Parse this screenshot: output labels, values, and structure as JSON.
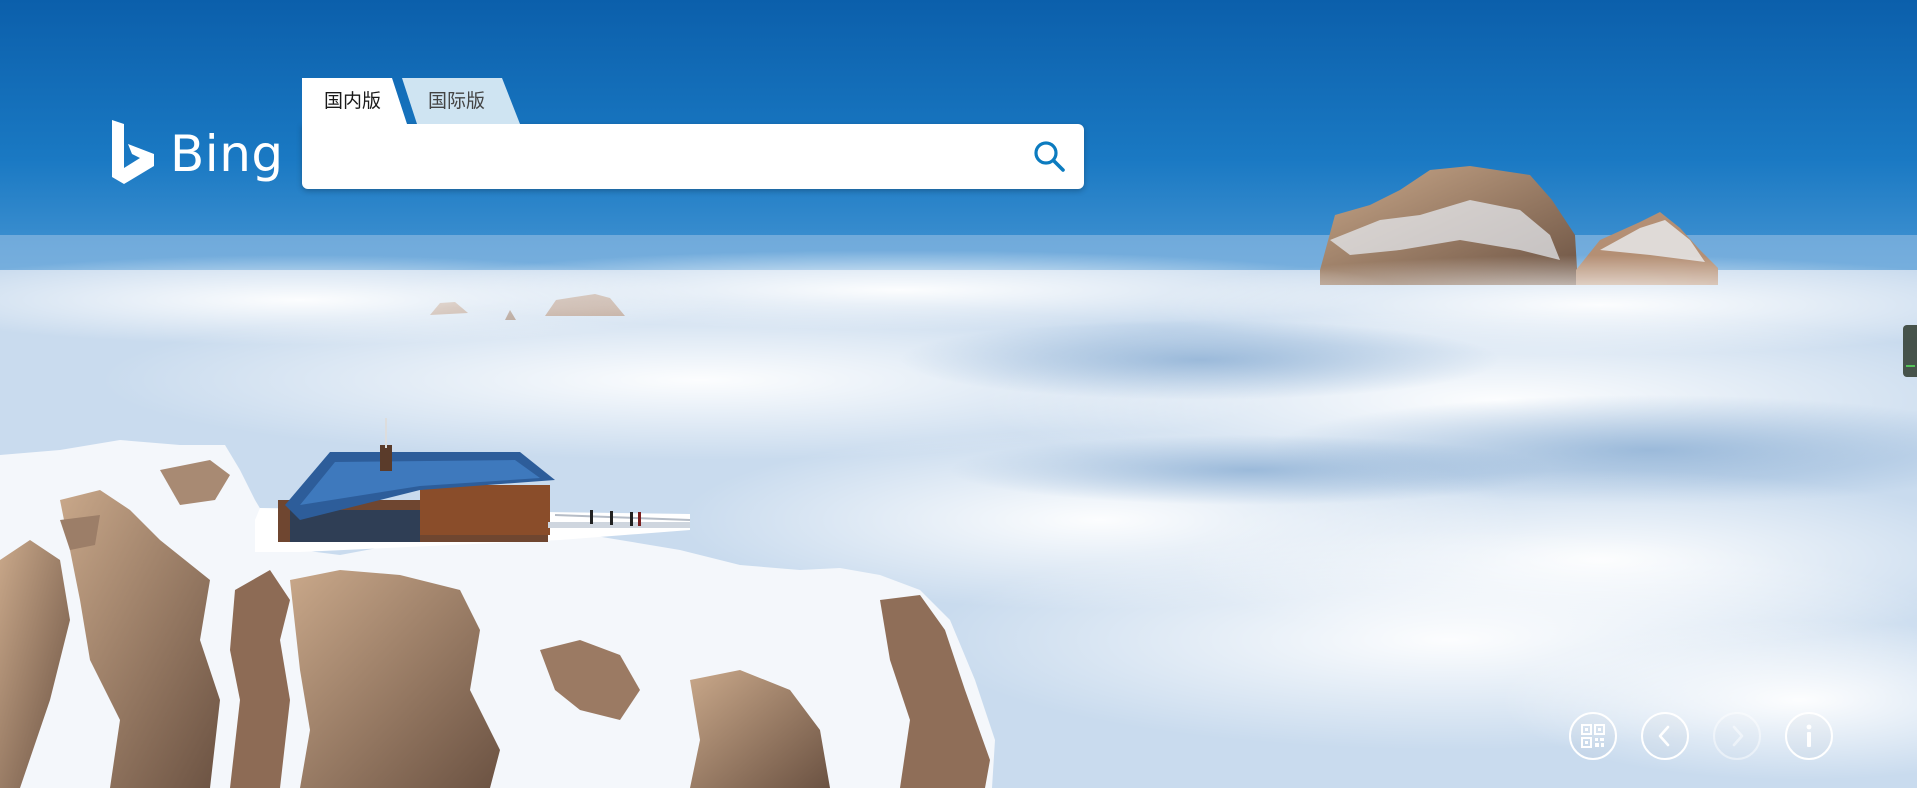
{
  "brand": {
    "logo_text": "Bing",
    "logo_icon": "bing-b-logo-icon"
  },
  "search": {
    "tabs": [
      {
        "label": "国内版",
        "active": true
      },
      {
        "label": "国际版",
        "active": false
      }
    ],
    "value": "",
    "placeholder": "",
    "button_icon": "search-icon"
  },
  "controls": [
    {
      "icon": "qr-code-icon",
      "enabled": true
    },
    {
      "icon": "chevron-left-icon",
      "enabled": true
    },
    {
      "icon": "chevron-right-icon",
      "enabled": false
    },
    {
      "icon": "info-icon",
      "enabled": true
    }
  ],
  "colors": {
    "sky_top": "#0d62ad",
    "search_icon": "#0c7bbf",
    "tab_inactive": "#cfe4f2"
  }
}
